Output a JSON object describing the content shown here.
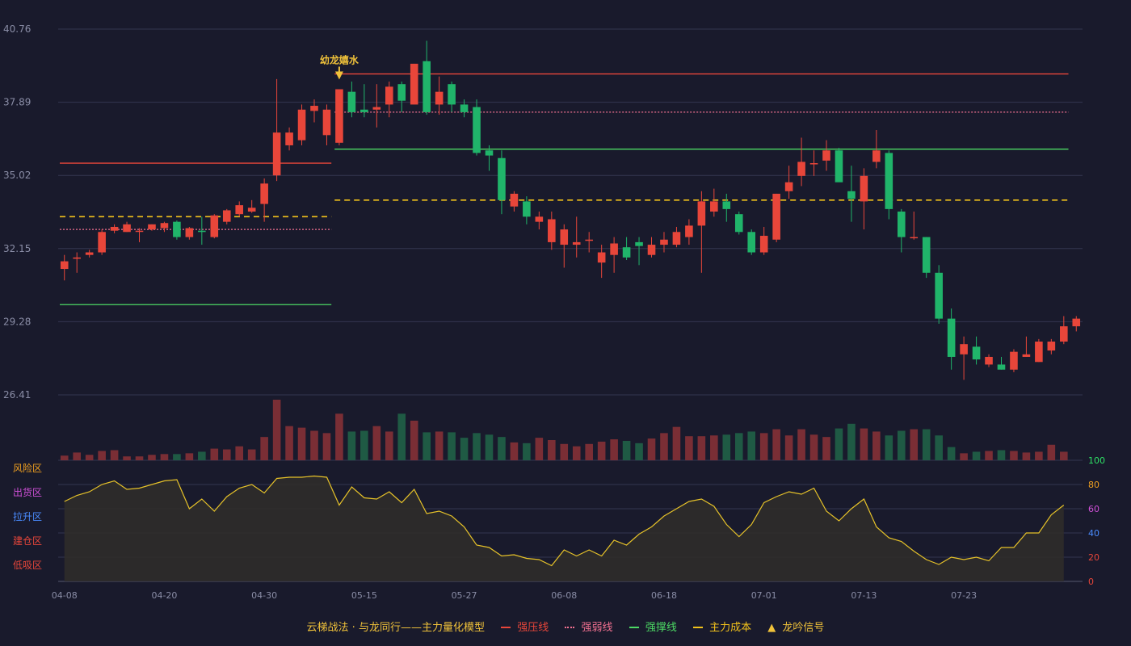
{
  "colors": {
    "background": "#191a2c",
    "grid": "#343650",
    "up": "#e8463a",
    "down": "#20b46a",
    "volume_up": "#7a2e35",
    "volume_down": "#1f5a44",
    "resistance": "#e8463a",
    "weak": "#f07090",
    "support": "#4cd964",
    "cost": "#f2c21b",
    "signal": "#f0c23a",
    "osc_line": "#e6c229",
    "osc_fill": "#2f2c2a",
    "axis_text": "#8a8da6"
  },
  "legend": {
    "title": "云梯战法 · 与龙同行——主力量化模型",
    "resistance": "强压线",
    "weak": "强弱线",
    "support": "强撑线",
    "cost": "主力成本",
    "signal": "龙吟信号"
  },
  "chart_data": {
    "type": "candlestick",
    "price_axis": {
      "ticks": [
        "40.76",
        "37.89",
        "35.02",
        "32.15",
        "29.28",
        "26.41"
      ],
      "range": [
        26.41,
        40.76
      ]
    },
    "x_labels": [
      {
        "index": 0,
        "label": "04-08"
      },
      {
        "index": 8,
        "label": "04-20"
      },
      {
        "index": 16,
        "label": "04-30"
      },
      {
        "index": 24,
        "label": "05-15"
      },
      {
        "index": 32,
        "label": "05-27"
      },
      {
        "index": 40,
        "label": "06-08"
      },
      {
        "index": 48,
        "label": "06-18"
      },
      {
        "index": 56,
        "label": "07-01"
      },
      {
        "index": 64,
        "label": "07-13"
      },
      {
        "index": 72,
        "label": "07-23"
      }
    ],
    "candles": [
      [
        31.35,
        31.9,
        30.9,
        31.65
      ],
      [
        31.75,
        32.0,
        31.2,
        31.8
      ],
      [
        31.9,
        32.1,
        31.8,
        32.0
      ],
      [
        32.0,
        32.9,
        31.9,
        32.8
      ],
      [
        32.85,
        33.1,
        32.75,
        33.0
      ],
      [
        32.8,
        33.2,
        32.8,
        33.1
      ],
      [
        32.85,
        32.95,
        32.4,
        32.85
      ],
      [
        32.9,
        33.1,
        32.85,
        33.1
      ],
      [
        32.95,
        33.2,
        32.8,
        33.15
      ],
      [
        33.2,
        33.25,
        32.5,
        32.6
      ],
      [
        32.6,
        33.0,
        32.5,
        32.95
      ],
      [
        32.85,
        33.4,
        32.3,
        32.8
      ],
      [
        32.6,
        33.5,
        32.55,
        33.45
      ],
      [
        33.2,
        33.7,
        33.1,
        33.65
      ],
      [
        33.5,
        34.0,
        33.4,
        33.85
      ],
      [
        33.6,
        34.05,
        33.55,
        33.75
      ],
      [
        33.9,
        34.9,
        33.2,
        34.7
      ],
      [
        35.02,
        38.8,
        34.8,
        36.7
      ],
      [
        36.2,
        36.9,
        36.0,
        36.7
      ],
      [
        36.4,
        37.8,
        36.2,
        37.6
      ],
      [
        37.55,
        38.0,
        37.1,
        37.75
      ],
      [
        36.6,
        37.8,
        36.2,
        37.6
      ],
      [
        36.3,
        38.4,
        36.2,
        38.4
      ],
      [
        38.3,
        38.7,
        37.3,
        37.5
      ],
      [
        37.6,
        38.6,
        37.3,
        37.5
      ],
      [
        37.6,
        38.6,
        36.9,
        37.7
      ],
      [
        37.8,
        38.7,
        37.3,
        38.5
      ],
      [
        38.6,
        38.7,
        37.5,
        37.95
      ],
      [
        37.8,
        39.4,
        37.8,
        39.4
      ],
      [
        39.5,
        40.3,
        37.4,
        37.5
      ],
      [
        37.8,
        38.9,
        37.4,
        38.3
      ],
      [
        38.6,
        38.7,
        37.5,
        37.8
      ],
      [
        37.8,
        38.0,
        37.3,
        37.5
      ],
      [
        37.7,
        38.0,
        35.8,
        35.9
      ],
      [
        36.0,
        36.2,
        35.2,
        35.8
      ],
      [
        35.7,
        36.0,
        33.5,
        34.05
      ],
      [
        33.8,
        34.4,
        33.6,
        34.3
      ],
      [
        34.0,
        34.2,
        33.1,
        33.4
      ],
      [
        33.2,
        33.6,
        32.9,
        33.4
      ],
      [
        32.4,
        33.6,
        32.1,
        33.3
      ],
      [
        32.3,
        33.1,
        31.4,
        32.9
      ],
      [
        32.3,
        33.4,
        31.8,
        32.4
      ],
      [
        32.5,
        32.8,
        32.0,
        32.5
      ],
      [
        31.6,
        32.3,
        31.0,
        32.0
      ],
      [
        31.9,
        32.6,
        31.2,
        32.35
      ],
      [
        32.2,
        32.6,
        31.7,
        31.8
      ],
      [
        32.4,
        32.6,
        31.5,
        32.25
      ],
      [
        31.9,
        32.6,
        31.8,
        32.3
      ],
      [
        32.3,
        32.8,
        32.0,
        32.5
      ],
      [
        32.3,
        33.0,
        32.2,
        32.8
      ],
      [
        32.6,
        33.3,
        32.3,
        33.05
      ],
      [
        33.05,
        34.4,
        31.2,
        34.0
      ],
      [
        33.6,
        34.5,
        33.4,
        34.0
      ],
      [
        34.0,
        34.3,
        33.2,
        33.7
      ],
      [
        33.5,
        33.6,
        32.7,
        32.8
      ],
      [
        32.8,
        32.9,
        31.9,
        32.0
      ],
      [
        32.0,
        33.0,
        31.9,
        32.65
      ],
      [
        32.5,
        34.3,
        32.4,
        34.3
      ],
      [
        34.4,
        35.4,
        34.1,
        34.75
      ],
      [
        35.0,
        36.5,
        34.6,
        35.55
      ],
      [
        35.5,
        36.0,
        35.0,
        35.5
      ],
      [
        35.6,
        36.4,
        35.2,
        36.0
      ],
      [
        36.0,
        36.1,
        34.8,
        34.75
      ],
      [
        34.4,
        35.4,
        33.2,
        34.1
      ],
      [
        34.0,
        35.3,
        32.9,
        35.0
      ],
      [
        35.55,
        36.8,
        35.3,
        36.0
      ],
      [
        35.9,
        36.0,
        33.3,
        33.7
      ],
      [
        33.6,
        33.7,
        32.0,
        32.6
      ],
      [
        32.6,
        33.6,
        32.5,
        32.6
      ],
      [
        32.6,
        32.6,
        31.0,
        31.2
      ],
      [
        31.2,
        31.5,
        29.2,
        29.4
      ],
      [
        29.4,
        29.8,
        27.4,
        27.9
      ],
      [
        28.0,
        28.7,
        27.0,
        28.4
      ],
      [
        28.3,
        28.7,
        27.6,
        27.8
      ],
      [
        27.6,
        28.0,
        27.5,
        27.9
      ],
      [
        27.6,
        27.9,
        27.4,
        27.4
      ],
      [
        27.4,
        28.2,
        27.3,
        28.1
      ],
      [
        27.9,
        28.7,
        27.9,
        28.0
      ],
      [
        27.7,
        28.6,
        27.7,
        28.5
      ],
      [
        28.15,
        28.6,
        28.0,
        28.5
      ],
      [
        28.5,
        29.5,
        28.4,
        29.1
      ],
      [
        29.1,
        29.5,
        28.9,
        29.4
      ]
    ],
    "volume": [
      6,
      10,
      7,
      12,
      13,
      5,
      5,
      7,
      8,
      8,
      9,
      11,
      15,
      14,
      18,
      14,
      30,
      78,
      44,
      42,
      38,
      35,
      60,
      37,
      38,
      44,
      37,
      60,
      51,
      36,
      37,
      36,
      29,
      35,
      33,
      30,
      23,
      22,
      29,
      26,
      21,
      18,
      21,
      24,
      27,
      25,
      22,
      28,
      35,
      43,
      31,
      31,
      32,
      33,
      35,
      37,
      35,
      40,
      32,
      40,
      33,
      30,
      41,
      47,
      41,
      37,
      32,
      38,
      40,
      40,
      32,
      17,
      9,
      11,
      12,
      13,
      12,
      10,
      11,
      20,
      11
    ],
    "oscillator": {
      "axis_ticks": [
        0,
        20,
        40,
        60,
        80,
        100
      ],
      "zones": [
        "风险区",
        "出货区",
        "拉升区",
        "建仓区",
        "低吸区"
      ],
      "values": [
        66,
        71,
        74,
        80,
        83,
        76,
        77,
        80,
        83,
        84,
        60,
        68,
        58,
        70,
        77,
        80,
        73,
        85,
        86,
        86,
        87,
        86,
        63,
        78,
        69,
        68,
        74,
        65,
        76,
        56,
        58,
        54,
        45,
        30,
        28,
        21,
        22,
        19,
        18,
        13,
        26,
        21,
        26,
        21,
        34,
        30,
        39,
        45,
        54,
        60,
        66,
        68,
        62,
        47,
        37,
        47,
        65,
        70,
        74,
        72,
        77,
        58,
        50,
        60,
        68,
        45,
        36,
        33,
        25,
        18,
        14,
        20,
        18,
        20,
        17,
        28,
        28,
        40,
        40,
        55,
        63
      ]
    },
    "lines": [
      {
        "kind": "resistance",
        "from": 0,
        "to": 21,
        "y": 35.5
      },
      {
        "kind": "weak",
        "from": 0,
        "to": 21,
        "y": 32.9
      },
      {
        "kind": "cost",
        "from": 0,
        "to": 21,
        "y": 33.4
      },
      {
        "kind": "support",
        "from": 0,
        "to": 21,
        "y": 29.95
      },
      {
        "kind": "resistance",
        "from": 22,
        "to": 80,
        "y": 39.0
      },
      {
        "kind": "weak",
        "from": 22,
        "to": 80,
        "y": 37.5
      },
      {
        "kind": "support",
        "from": 22,
        "to": 80,
        "y": 36.05
      },
      {
        "kind": "cost",
        "from": 22,
        "to": 80,
        "y": 34.05
      }
    ],
    "signal": {
      "index": 22,
      "label": "幼龙嬉水"
    }
  }
}
